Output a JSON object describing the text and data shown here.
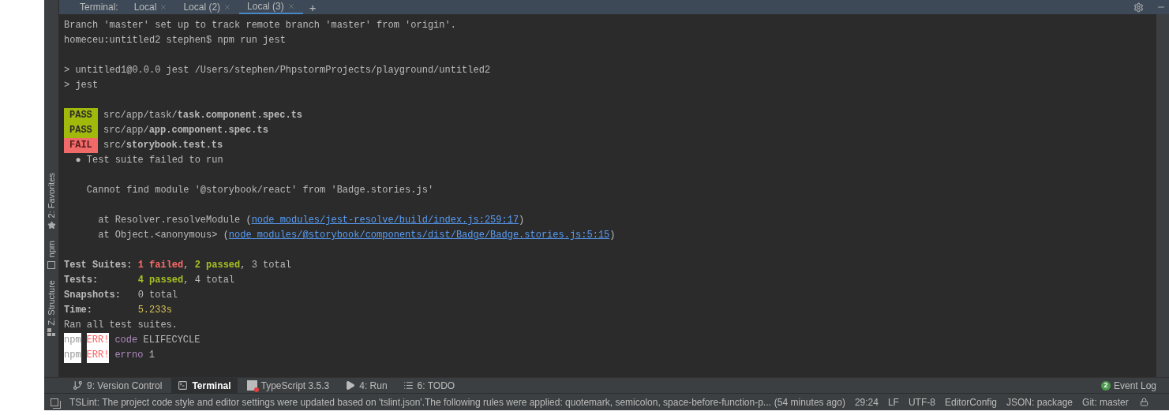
{
  "side_strip": {
    "items": [
      {
        "label": "2: Favorites",
        "kind": "star"
      },
      {
        "label": "npm",
        "kind": "npm"
      },
      {
        "label": "Z: Structure",
        "kind": "structure"
      }
    ]
  },
  "terminal_tabs": {
    "title": "Terminal:",
    "tabs": [
      {
        "label": "Local",
        "selected": false
      },
      {
        "label": "Local (2)",
        "selected": false
      },
      {
        "label": "Local (3)",
        "selected": true
      }
    ],
    "add": "+"
  },
  "output": [
    [
      [
        {
          "text": "Branch 'master' set up to track remote branch 'master' from 'origin'.",
          "kind": "plain"
        }
      ],
      [
        {
          "text": "homeceu:untitled2 stephen$ npm run jest",
          "kind": "plain"
        }
      ]
    ],
    [
      [
        {
          "text": "> untitled1@0.0.0 jest /Users/stephen/PhpstormProjects/playground/untitled2",
          "kind": "plain"
        }
      ],
      [
        {
          "text": "> jest",
          "kind": "plain"
        }
      ]
    ],
    [
      [
        {
          "text": "PASS",
          "kind": "pass"
        },
        {
          "text": " src/app/task/",
          "kind": "plain"
        },
        {
          "text": "task.component.spec.ts",
          "kind": "bold"
        }
      ],
      [
        {
          "text": "PASS",
          "kind": "pass"
        },
        {
          "text": " src/app/",
          "kind": "plain"
        },
        {
          "text": "app.component.spec.ts",
          "kind": "bold"
        }
      ],
      [
        {
          "text": "FAIL",
          "kind": "fail"
        },
        {
          "text": " src/",
          "kind": "plain"
        },
        {
          "text": "storybook.test.ts",
          "kind": "bold"
        }
      ],
      [
        {
          "text": "  ● Test suite failed to run",
          "kind": "plain"
        }
      ]
    ],
    [
      [
        {
          "text": "    Cannot find module '@storybook/react' from 'Badge.stories.js'",
          "kind": "plain"
        }
      ]
    ],
    [
      [
        {
          "text": "      at Resolver.resolveModule (",
          "kind": "plain"
        },
        {
          "text": "node_modules/jest-resolve/build/index.js:259:17",
          "kind": "link"
        },
        {
          "text": ")",
          "kind": "plain"
        }
      ],
      [
        {
          "text": "      at Object.<anonymous> (",
          "kind": "plain"
        },
        {
          "text": "node_modules/@storybook/components/dist/Badge/Badge.stories.js:5:15",
          "kind": "link"
        },
        {
          "text": ")",
          "kind": "plain"
        }
      ]
    ],
    [
      [
        {
          "text": "Test Suites: ",
          "kind": "bold"
        },
        {
          "text": "1 failed",
          "kind": "red"
        },
        {
          "text": ", ",
          "kind": "plain"
        },
        {
          "text": "2 passed",
          "kind": "green"
        },
        {
          "text": ", 3 total",
          "kind": "plain"
        }
      ],
      [
        {
          "text": "Tests:       ",
          "kind": "bold"
        },
        {
          "text": "4 passed",
          "kind": "green"
        },
        {
          "text": ", 4 total",
          "kind": "plain"
        }
      ],
      [
        {
          "text": "Snapshots:   ",
          "kind": "bold"
        },
        {
          "text": "0 total",
          "kind": "plain"
        }
      ],
      [
        {
          "text": "Time:        ",
          "kind": "bold"
        },
        {
          "text": "5.233s",
          "kind": "yellow"
        }
      ],
      [
        {
          "text": "Ran all test suites.",
          "kind": "plain"
        }
      ],
      [
        {
          "text": "npm",
          "kind": "npm"
        },
        {
          "text": "ERR!",
          "kind": "err"
        },
        {
          "text": "code",
          "kind": "purple"
        },
        {
          "text": " ELIFECYCLE",
          "kind": "plain"
        }
      ],
      [
        {
          "text": "npm",
          "kind": "npm"
        },
        {
          "text": "ERR!",
          "kind": "err"
        },
        {
          "text": "errno",
          "kind": "purple"
        },
        {
          "text": " 1",
          "kind": "plain"
        }
      ]
    ]
  ],
  "tool_windows": [
    {
      "label": "9: Version Control",
      "kind": "vcs",
      "selected": false
    },
    {
      "label": "Terminal",
      "kind": "terminal",
      "selected": true
    },
    {
      "label": "TypeScript 3.5.3",
      "kind": "ts",
      "selected": false
    },
    {
      "label": "4: Run",
      "kind": "run",
      "selected": false
    },
    {
      "label": "6: TODO",
      "kind": "todo",
      "selected": false
    }
  ],
  "event_log": {
    "count": "2",
    "label": "Event Log"
  },
  "status_bar": {
    "message": "TSLint: The project code style and editor settings were updated based on 'tslint.json'.The following rules were applied: quotemark, semicolon, space-before-function-p...",
    "time": "(54 minutes ago)",
    "items": [
      "29:24",
      "LF",
      "UTF-8",
      "EditorConfig",
      "JSON: package",
      "Git: master"
    ]
  }
}
